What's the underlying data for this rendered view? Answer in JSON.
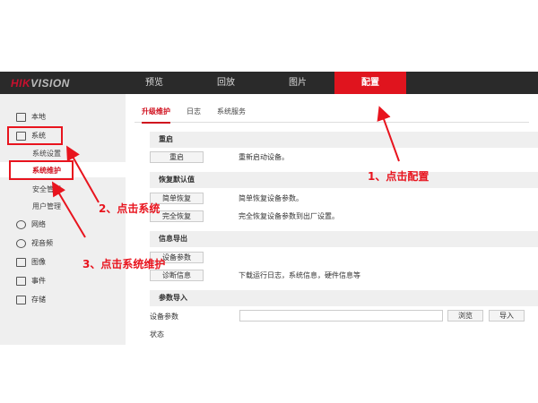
{
  "header": {
    "logo_red": "HIK",
    "logo_gray": "VISION",
    "nav": [
      "预览",
      "回放",
      "图片",
      "配置"
    ],
    "active": "配置"
  },
  "sidebar": {
    "items": [
      "本地",
      "系统",
      "网络",
      "视音频",
      "图像",
      "事件",
      "存储"
    ],
    "sub": [
      "系统设置",
      "系统维护",
      "安全管理",
      "用户管理"
    ]
  },
  "tabs": [
    "升级维护",
    "日志",
    "系统服务"
  ],
  "sections": {
    "reboot": {
      "title": "重启",
      "button": "重启",
      "desc": "重新启动设备。"
    },
    "restore": {
      "title": "恢复默认值",
      "simple_button": "简单恢复",
      "simple_desc": "简单恢复设备参数。",
      "full_button": "完全恢复",
      "full_desc": "完全恢复设备参数到出厂设置。"
    },
    "export": {
      "title": "信息导出",
      "params_button": "设备参数",
      "diag_button": "诊断信息",
      "diag_desc": "下载运行日志，系统信息，硬件信息等"
    },
    "import": {
      "title": "参数导入",
      "label": "设备参数",
      "input_value": "",
      "browse": "浏览",
      "import": "导入",
      "status_label": "状态"
    }
  },
  "annotations": [
    "1、点击配置",
    "2、点击系统",
    "3、点击系统维护"
  ],
  "colors": {
    "accent": "#e0141e",
    "header": "#2a2a2a"
  }
}
